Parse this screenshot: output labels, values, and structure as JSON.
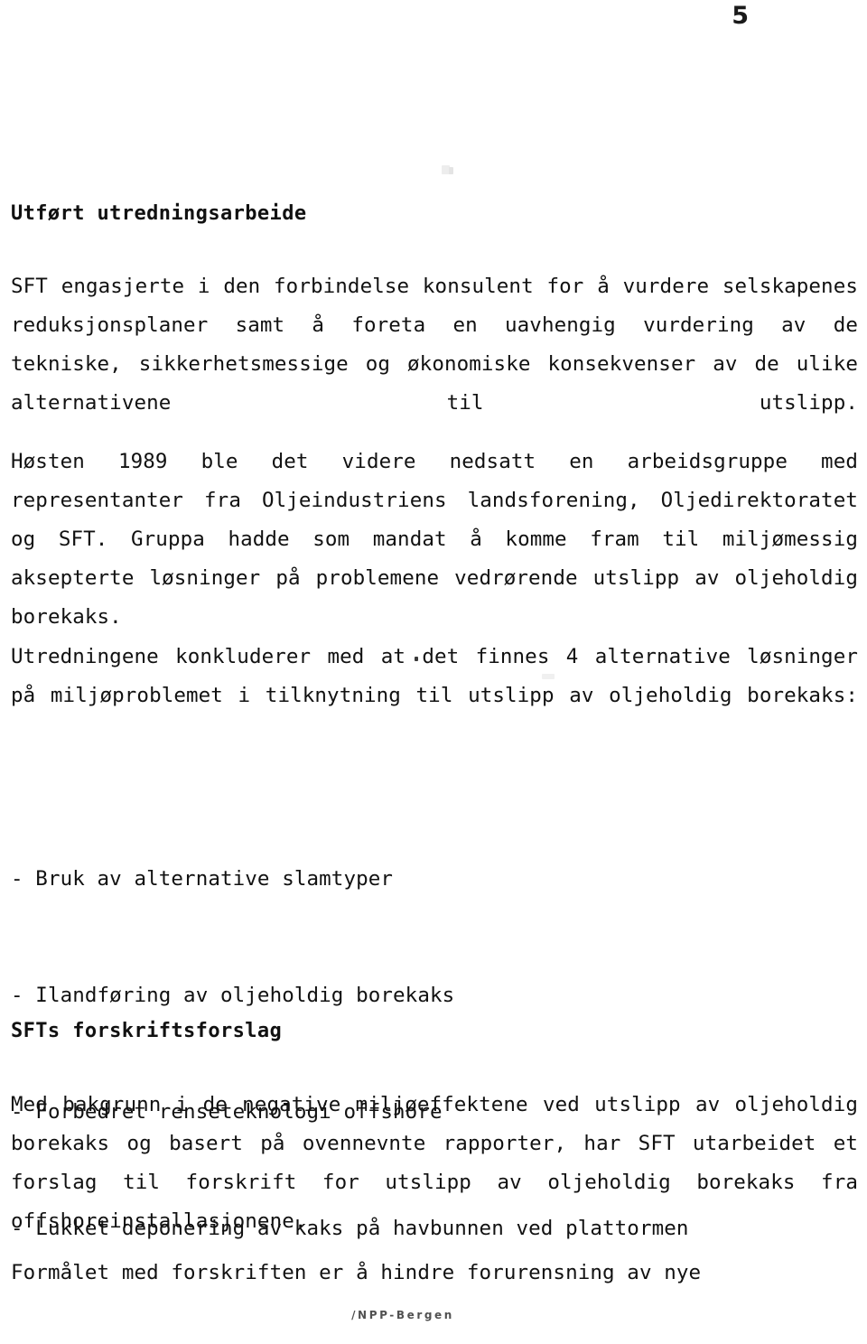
{
  "page": {
    "number": "5",
    "footer_mark": "/NPP-Bergen"
  },
  "sections": [
    {
      "heading": "Utført utredningsarbeide",
      "paragraphs": [
        "SFT engasjerte i den forbindelse konsulent for å vurdere selskapenes reduksjonsplaner samt å foreta en uavhengig vurdering av de tekniske, sikkerhetsmessige og økonomiske konsekvenser av de ulike alternativene til utslipp.",
        "Høsten 1989 ble det videre nedsatt en arbeidsgruppe med representanter fra Oljeindustriens landsforening, Oljedirektoratet og SFT. Gruppa hadde som mandat å komme fram til miljømessig aksepterte løsninger på problemene vedrørende utslipp av oljeholdig borekaks.",
        "Utredningene konkluderer med at det finnes 4 alternative løsninger på miljøproblemet i tilknytning til utslipp av oljeholdig borekaks:"
      ],
      "list": [
        "- Bruk av alternative slamtyper",
        "- Ilandføring av oljeholdig borekaks",
        "- Forbedret renseteknologi offshore",
        "- Lukket deponering av kaks på havbunnen ved plattormen"
      ]
    },
    {
      "heading": "SFTs forskriftsforslag",
      "paragraphs": [
        "Med bakgrunn i de negative miljøeffektene ved utslipp av oljeholdig borekaks og basert på ovennevnte rapporter, har SFT utarbeidet et forslag til forskrift for utslipp av oljeholdig borekaks fra offshoreinstallasjonene.",
        "Formålet med forskriften er å hindre forurensning av nye"
      ]
    }
  ]
}
